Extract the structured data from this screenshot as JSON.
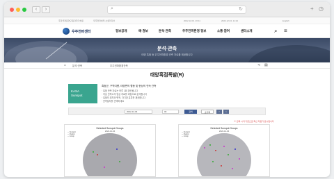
{
  "browser": {
    "url": "",
    "icons": {
      "back": "chevron-left-icon",
      "forward": "chevron-right-icon",
      "search": "search-icon",
      "reload": "reload-icon",
      "new_tab": "plus-icon",
      "history": "clock-icon"
    }
  },
  "utility_bar": {
    "left": [
      "주한국천문연구원과학기술원",
      "우주전파센터 소셜미디어"
    ],
    "date1": "2022.12.04. 20:11",
    "date2": "2022.12.04. 11:24",
    "right": "English"
  },
  "header": {
    "logo_text": "우주전파센터",
    "menu": [
      "정보공개",
      "예·경보",
      "분석·관측",
      "우주전파환경 정보",
      "소통·참여",
      "센터소개"
    ],
    "icons": {
      "search": "search-icon",
      "menu": "hamburger-menu-icon"
    }
  },
  "banner": {
    "title": "분석·관측",
    "subtitle": "태양 흑점 등 우주전파환경 관측 자료를 제공합니다"
  },
  "breadcrumb": {
    "home_icon": "home-icon",
    "items": [
      "분석·관측",
      "우주전파환경관측"
    ],
    "share_icon": "share-icon",
    "print_icon": "print-icon"
  },
  "page": {
    "title": "태양흑점폭발(R)",
    "info_box": {
      "line1": "KASA",
      "line2": "Sunspot"
    },
    "info_lead": "흑점군, 구역이름, 태양면의 활동 및 현상의 연속 관측",
    "info_lines": [
      "· 흑점 관측 자료는 하루 1회 갱신됩니다",
      "· 지상 관측소의 영상 자료를 바탕으로 분석합니다",
      "· 흑점의 위치와 면적, 자기장 분류를 제공합니다",
      "· 관측일자를 선택하세요"
    ],
    "filter": {
      "date_value": "2022-12-04",
      "select_value": "00",
      "search_label": "검색",
      "reset_label": "초기화",
      "prev_label": "<",
      "next_label": ">"
    },
    "note": "※ 관측 시각 기준으로 최신 자료가 표시됩니다",
    "plots": [
      {
        "title": "Detected Sunspot Groups",
        "subtitle": "2022-12-04",
        "legend": [
          "— Sunspot",
          "— Region",
          "— Group"
        ]
      },
      {
        "title": "Detected Sunspot Groups",
        "subtitle": "2022-12-04",
        "legend": [
          "— Sunspot",
          "— Region",
          "— Group"
        ]
      }
    ]
  }
}
